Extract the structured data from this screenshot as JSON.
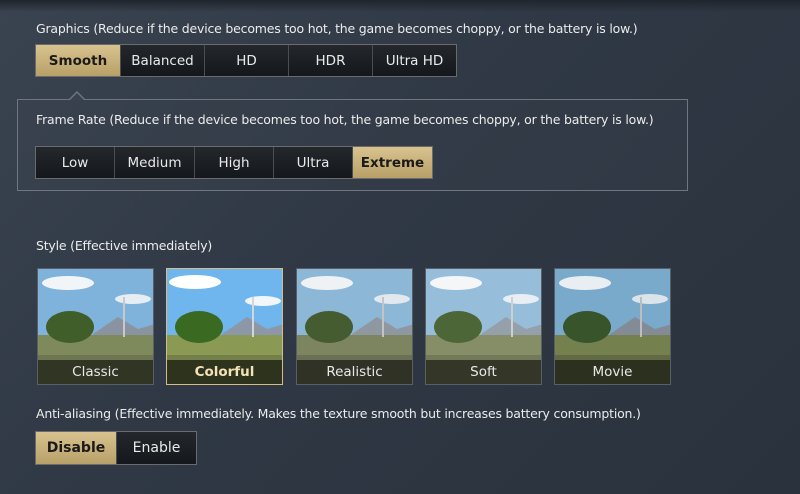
{
  "graphics": {
    "label": "Graphics (Reduce if the device becomes too hot, the game becomes choppy, or the battery is low.)",
    "options": [
      "Smooth",
      "Balanced",
      "HD",
      "HDR",
      "Ultra HD"
    ],
    "selected": "Smooth"
  },
  "frame_rate": {
    "label": "Frame Rate (Reduce if the device becomes too hot, the game becomes choppy, or the battery is low.)",
    "options": [
      "Low",
      "Medium",
      "High",
      "Ultra",
      "Extreme"
    ],
    "selected": "Extreme"
  },
  "style": {
    "label": "Style (Effective immediately)",
    "options": [
      "Classic",
      "Colorful",
      "Realistic",
      "Soft",
      "Movie"
    ],
    "selected": "Colorful"
  },
  "anti_aliasing": {
    "label": "Anti-aliasing (Effective immediately. Makes the texture smooth but increases battery consumption.)",
    "options": [
      "Disable",
      "Enable"
    ],
    "selected": "Disable"
  },
  "colors": {
    "accent_gold": "#c9b27a",
    "background": "#2f3844"
  }
}
